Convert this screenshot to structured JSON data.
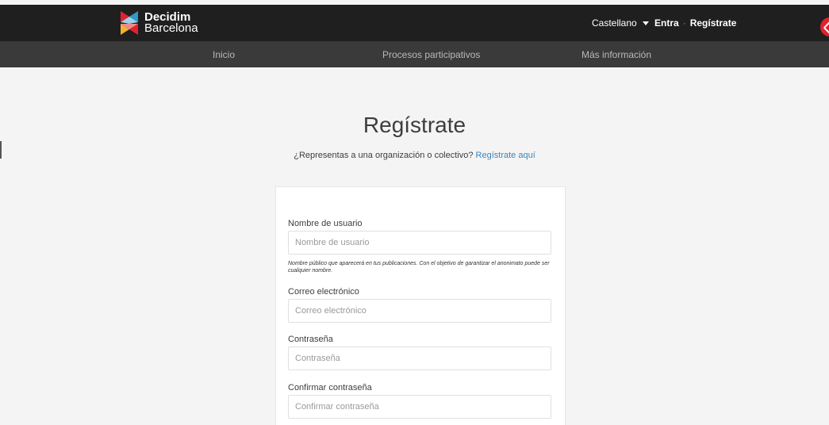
{
  "header": {
    "logo_line1": "Decidim",
    "logo_line2": "Barcelona",
    "language": "Castellano",
    "login": "Entra",
    "separator": "·",
    "register": "Regístrate"
  },
  "nav": {
    "items": [
      "Inicio",
      "Procesos participativos",
      "Más información"
    ]
  },
  "page": {
    "title": "Regístrate",
    "subtitle_text": "¿Representas a una organización o colectivo?",
    "subtitle_link": "Regístrate aquí"
  },
  "form": {
    "username_label": "Nombre de usuario",
    "username_placeholder": "Nombre de usuario",
    "username_help": "Nombre público que aparecerá en tus publicaciones. Con el objetivo de garantizar el anonimato puede ser cualquier nombre.",
    "email_label": "Correo electrónico",
    "email_placeholder": "Correo electrónico",
    "password_label": "Contraseña",
    "password_placeholder": "Contraseña",
    "confirm_label": "Confirmar contraseña",
    "confirm_placeholder": "Confirmar contraseña"
  },
  "colors": {
    "topbar": "#1f1f1f",
    "navbar": "#3a3a3a",
    "link": "#3a86b8",
    "accent": "#e4202e"
  }
}
